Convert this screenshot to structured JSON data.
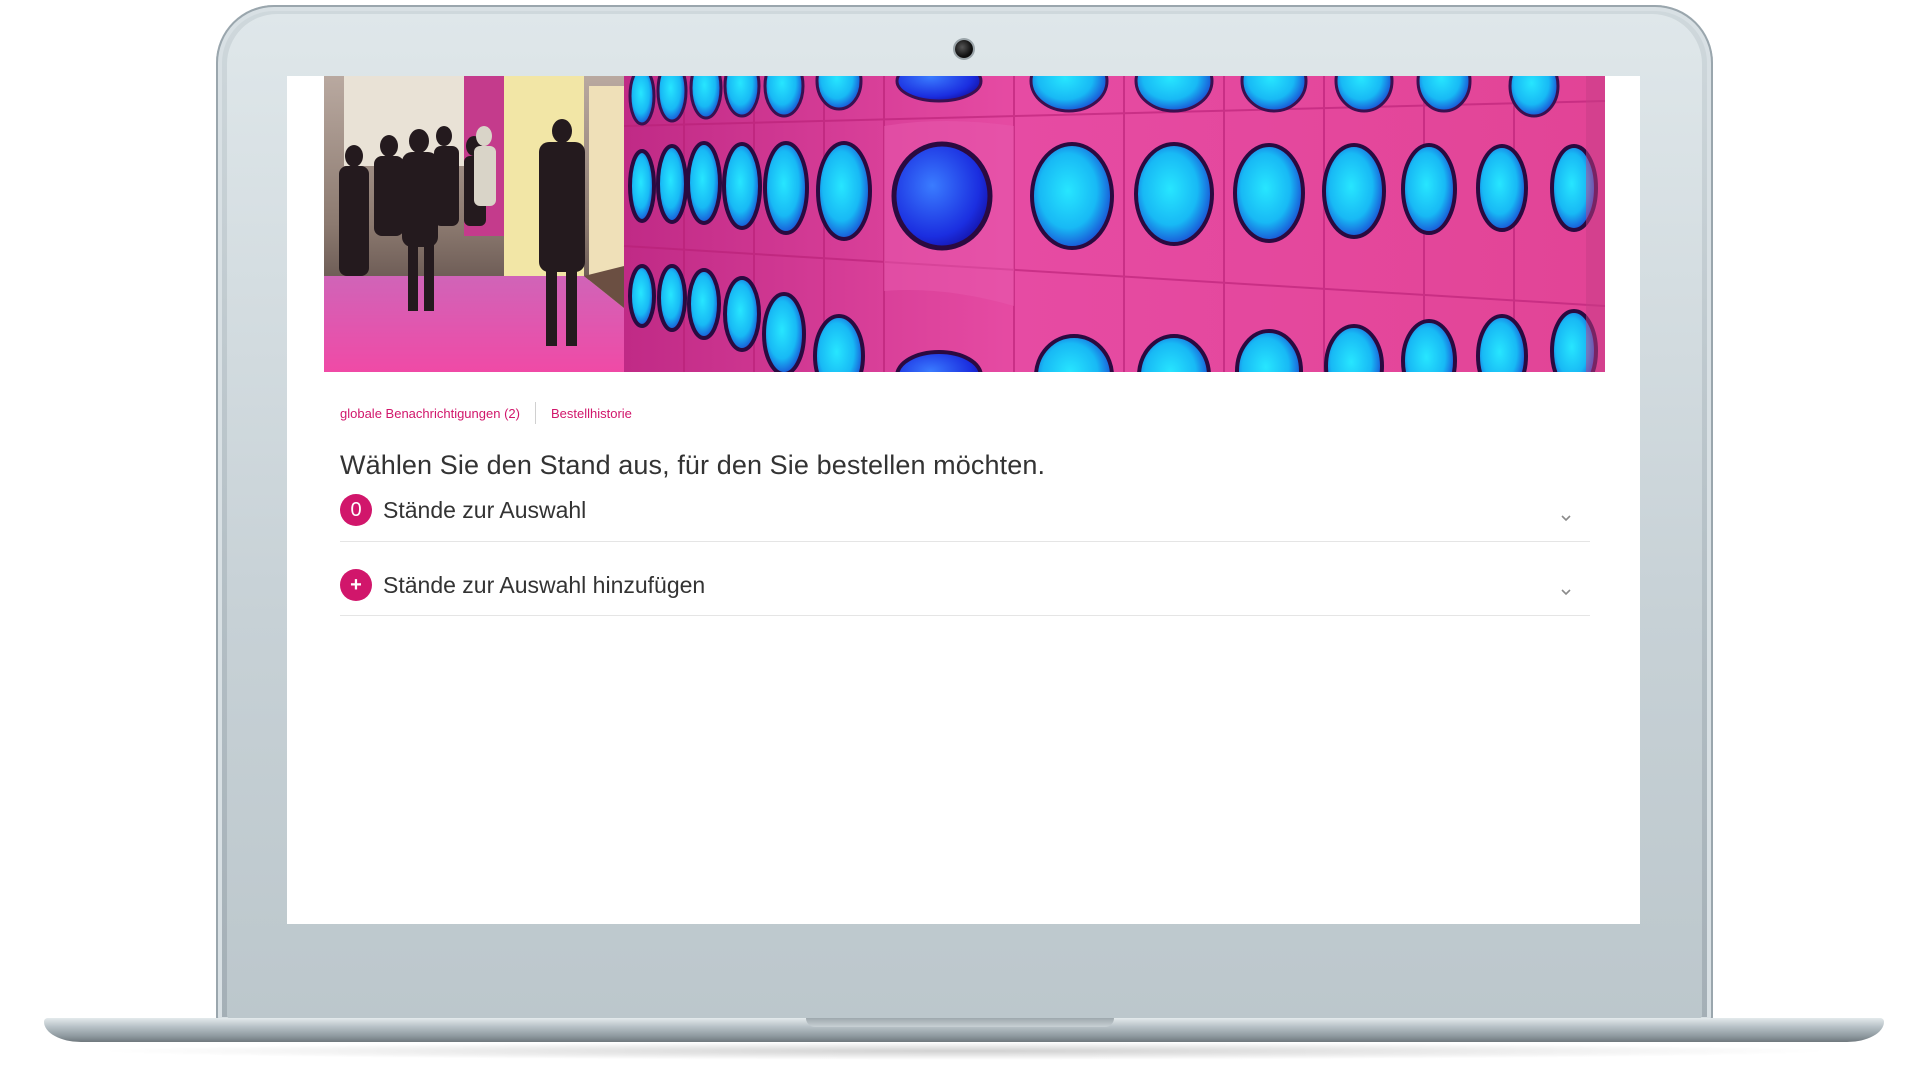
{
  "colors": {
    "accent": "#d1166b",
    "text": "#333333",
    "divider": "#e5e5e5"
  },
  "nav": {
    "notifications_label": "globale Benachrichtigungen (2)",
    "order_history_label": "Bestellhistorie"
  },
  "main": {
    "headline": "Wählen Sie den Stand aus, für den Sie bestellen möchten.",
    "sections": [
      {
        "badge": "0",
        "label": "Stände zur Auswahl",
        "icon": "chevron-down-icon"
      },
      {
        "badge": "+",
        "label": "Stände zur Auswahl hinzufügen",
        "icon": "chevron-down-icon"
      }
    ]
  },
  "hero": {
    "description_icon": "trade-fair-banner-image"
  }
}
